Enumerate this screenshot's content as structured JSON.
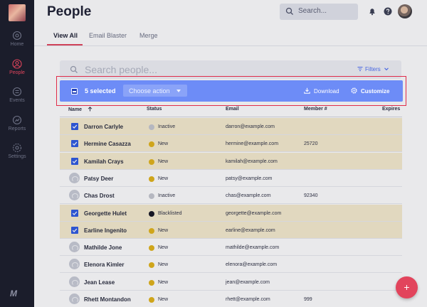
{
  "sidebar": {
    "items": [
      {
        "label": "Home",
        "icon": "home-icon"
      },
      {
        "label": "People",
        "icon": "person-icon"
      },
      {
        "label": "Events",
        "icon": "events-icon"
      },
      {
        "label": "Reports",
        "icon": "reports-icon"
      },
      {
        "label": "Settings",
        "icon": "gear-icon"
      }
    ],
    "active": "People",
    "logo_text": "M"
  },
  "header": {
    "title": "People",
    "search_placeholder": "Search..."
  },
  "tabs": [
    {
      "label": "View All"
    },
    {
      "label": "Email Blaster"
    },
    {
      "label": "Merge"
    }
  ],
  "people_search": {
    "placeholder": "Search people...",
    "filters_label": "Filters"
  },
  "selection_bar": {
    "count_label": "5 selected",
    "choose_action_label": "Choose action",
    "download_label": "Download",
    "customize_label": "Customize"
  },
  "table": {
    "columns": [
      "Name",
      "Status",
      "Email",
      "Member #",
      "Expires"
    ],
    "rows": [
      {
        "name": "Darron Carlyle",
        "status": "Inactive",
        "email": "darron@example.com",
        "member": "",
        "selected": true
      },
      {
        "name": "Hermine Casazza",
        "status": "New",
        "email": "hermine@example.com",
        "member": "25720",
        "selected": true
      },
      {
        "name": "Kamilah Crays",
        "status": "New",
        "email": "kamilah@example.com",
        "member": "",
        "selected": true
      },
      {
        "name": "Patsy Deer",
        "status": "New",
        "email": "patsy@example.com",
        "member": "",
        "selected": false
      },
      {
        "name": "Chas Drost",
        "status": "Inactive",
        "email": "chas@example.com",
        "member": "92340",
        "selected": false
      },
      {
        "name": "Georgette Hulet",
        "status": "Blacklisted",
        "email": "georgette@example.com",
        "member": "",
        "selected": true
      },
      {
        "name": "Earline Ingenito",
        "status": "New",
        "email": "earline@example.com",
        "member": "",
        "selected": true
      },
      {
        "name": "Mathilde Jone",
        "status": "New",
        "email": "mathilde@example.com",
        "member": "",
        "selected": false
      },
      {
        "name": "Elenora Kimler",
        "status": "New",
        "email": "elenora@example.com",
        "member": "",
        "selected": false
      },
      {
        "name": "Jean Lease",
        "status": "New",
        "email": "jean@example.com",
        "member": "",
        "selected": false
      },
      {
        "name": "Rhett Montandon",
        "status": "New",
        "email": "rhett@example.com",
        "member": "999",
        "selected": false
      }
    ]
  },
  "colors": {
    "accent": "#e2445c",
    "selection_bar": "#6d8cf7",
    "status_new": "#e2b418",
    "status_inactive": "#c6c8d0",
    "status_blacklisted": "#141522",
    "selected_row": "#f7edcf"
  },
  "fab": {
    "icon": "plus-icon",
    "label": "+"
  }
}
